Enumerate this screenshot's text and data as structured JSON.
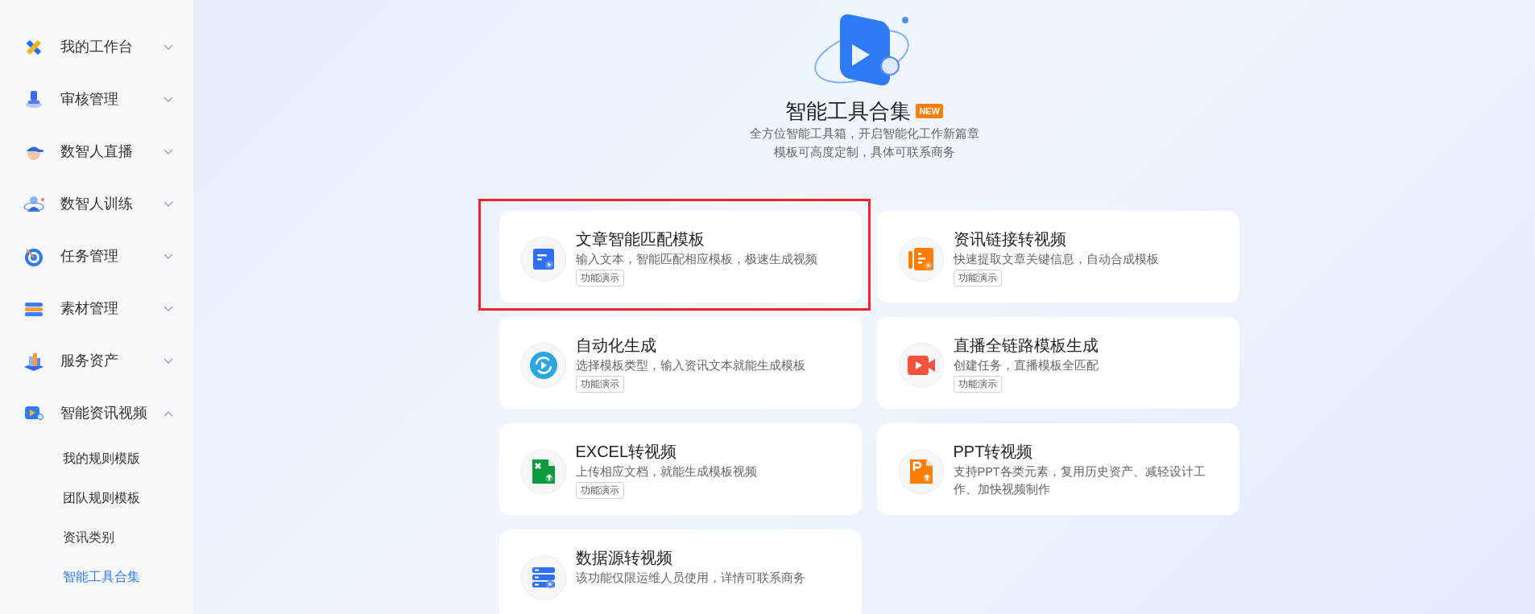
{
  "sidebar": {
    "items": [
      {
        "label": "我的工作台",
        "expanded": false
      },
      {
        "label": "审核管理",
        "expanded": false
      },
      {
        "label": "数智人直播",
        "expanded": false
      },
      {
        "label": "数智人训练",
        "expanded": false
      },
      {
        "label": "任务管理",
        "expanded": false
      },
      {
        "label": "素材管理",
        "expanded": false
      },
      {
        "label": "服务资产",
        "expanded": false
      },
      {
        "label": "智能资讯视频",
        "expanded": true,
        "children": [
          {
            "label": "我的规则模版",
            "selected": false
          },
          {
            "label": "团队规则模板",
            "selected": false
          },
          {
            "label": "资讯类别",
            "selected": false
          },
          {
            "label": "智能工具合集",
            "selected": true
          }
        ]
      }
    ]
  },
  "header": {
    "title": "智能工具合集",
    "badge": "NEW",
    "subtitle_lines": [
      "全方位智能工具箱，开启智能化工作新篇章",
      "模板可高度定制，具体可联系商务"
    ]
  },
  "cards": [
    {
      "title": "文章智能匹配模板",
      "description": "输入文本，智能匹配相应模板，极速生成视频",
      "demo": "功能演示",
      "highlighted": true
    },
    {
      "title": "资讯链接转视频",
      "description": "快速提取文章关键信息，自动合成模板",
      "demo": "功能演示",
      "highlighted": false
    },
    {
      "title": "自动化生成",
      "description": "选择模板类型，输入资讯文本就能生成模板",
      "demo": "功能演示",
      "highlighted": false
    },
    {
      "title": "直播全链路模板生成",
      "description": "创建任务，直播模板全匹配",
      "demo": "功能演示",
      "highlighted": false
    },
    {
      "title": "EXCEL转视频",
      "description": "上传相应文档，就能生成模板视频",
      "demo": "功能演示",
      "highlighted": false
    },
    {
      "title": "PPT转视频",
      "description": "支持PPT各类元素，复用历史资产、减轻设计工作、加快视频制作",
      "highlighted": false
    },
    {
      "title": "数据源转视频",
      "description": "该功能仅限运维人员使用，详情可联系商务",
      "highlighted": false
    }
  ]
}
